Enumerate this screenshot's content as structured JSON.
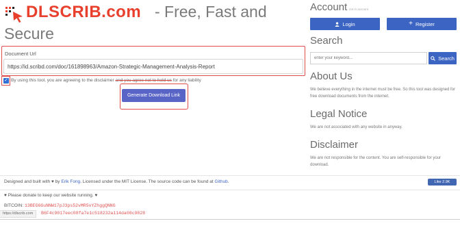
{
  "header": {
    "brand": "DLSCRIB.com",
    "tagline_line1": "- Free, Fast and",
    "tagline_line2": "Secure"
  },
  "form": {
    "url_label": "Document Url",
    "url_value": "https://id.scribd.com/doc/161898963/Amazon-Strategic-Management-Analysis-Report",
    "agree_text_part1": "By using this tool, you are agreeing to the disclaimer ",
    "agree_text_part2": "and you agree not to hold us",
    "agree_text_part3": " for any liability",
    "agree_checked": true,
    "generate_label": "Generate Download Link"
  },
  "sidebar": {
    "account_title": "Account",
    "account_sub": "not in account",
    "login_label": "Login",
    "register_label": "Register",
    "search_title": "Search",
    "search_placeholder": "enter your keyword...",
    "search_button": "Search",
    "about_title": "About Us",
    "about_text": "We believe everything in the internet must be free. So this tool was designed for free download documents from the internet.",
    "legal_title": "Legal Notice",
    "legal_text": "We are not associated with any website in anyway.",
    "disclaimer_title": "Disclaimer",
    "disclaimer_text": "We are not responsible for the content. You are self-responsible for your download."
  },
  "footer": {
    "credit_part1": "Designed and built with ♥ by ",
    "credit_author": "Erik Fong",
    "credit_part2": ". Licensed under the MIT License. The source code can be found at ",
    "credit_github": "Github",
    "credit_end": ".",
    "like_label": "Like 2.9K",
    "donate_text": "♥ Please donate to keep our website running. ♥",
    "bitcoin_label": "BITCOIN:",
    "bitcoin_addr": "13BEG6GuNNW17pJ3ps52vMR5vYZhggQNNG",
    "bitcoin_addr2": "B6F4c9017eec08fa7e1c518232a114da08c9828",
    "status_url": "https://dlscrib.com"
  },
  "colors": {
    "brand_red": "#e8402d",
    "accent_blue": "#3c64c2",
    "button_purple": "#5964c7",
    "highlight_red": "#e04b4b"
  },
  "icons": {
    "logo": "cursor-dots-icon",
    "login": "user-icon",
    "register": "plus-icon",
    "search": "search-icon",
    "check": "checkmark-icon"
  }
}
